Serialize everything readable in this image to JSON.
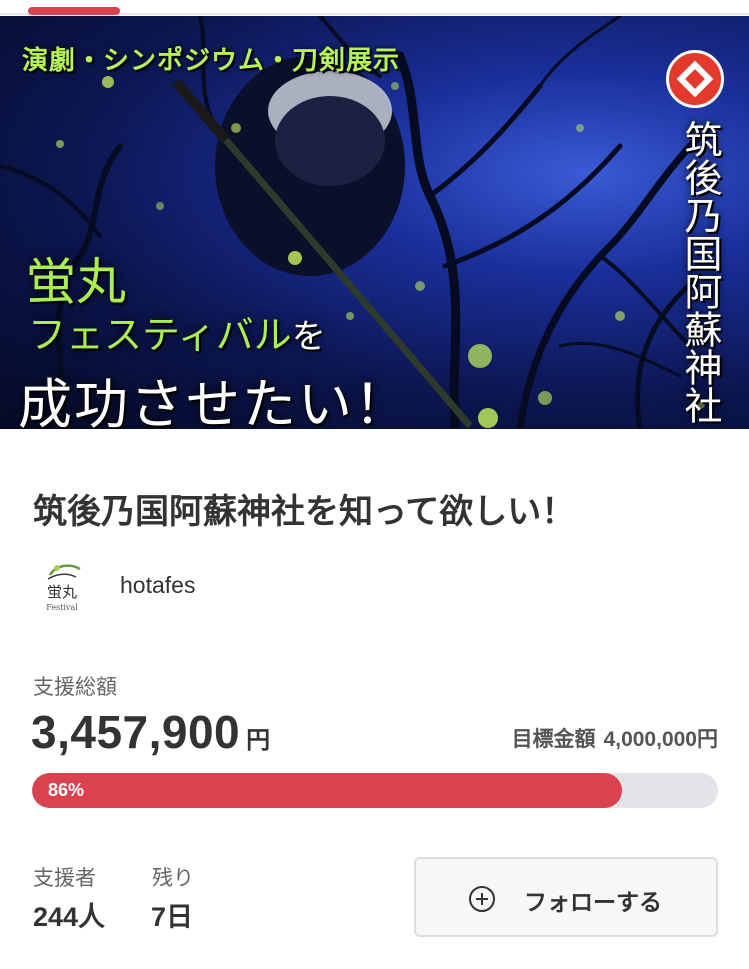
{
  "hero": {
    "top_caption": "演劇・シンポジウム・刀剣展示",
    "line1": "蛍丸",
    "line2": "フェスティバル",
    "line2_suffix": "を",
    "line3": "成功させたい！",
    "vertical_name": "筑後乃国阿蘇神社",
    "colors": {
      "caption_green": "#a9ef52",
      "crest_red": "#e23a2c"
    }
  },
  "project": {
    "title": "筑後乃国阿蘇神社を知って欲しい！",
    "owner": {
      "name": "hotafes",
      "logo_text": "蛍丸",
      "logo_subtext": "Festival"
    }
  },
  "funding": {
    "total_label": "支援総額",
    "total_amount": "3,457,900",
    "currency_unit": "円",
    "goal_label": "目標金額",
    "goal_amount": "4,000,000円",
    "progress_text": "86%",
    "progress_fraction": 0.86,
    "progress_color": "#d9434f"
  },
  "stats": {
    "backers_label": "支援者",
    "backers_value": "244人",
    "remaining_label": "残り",
    "remaining_value": "7日"
  },
  "follow_button": {
    "icon": "plus-circle-icon",
    "label": "フォローする"
  }
}
